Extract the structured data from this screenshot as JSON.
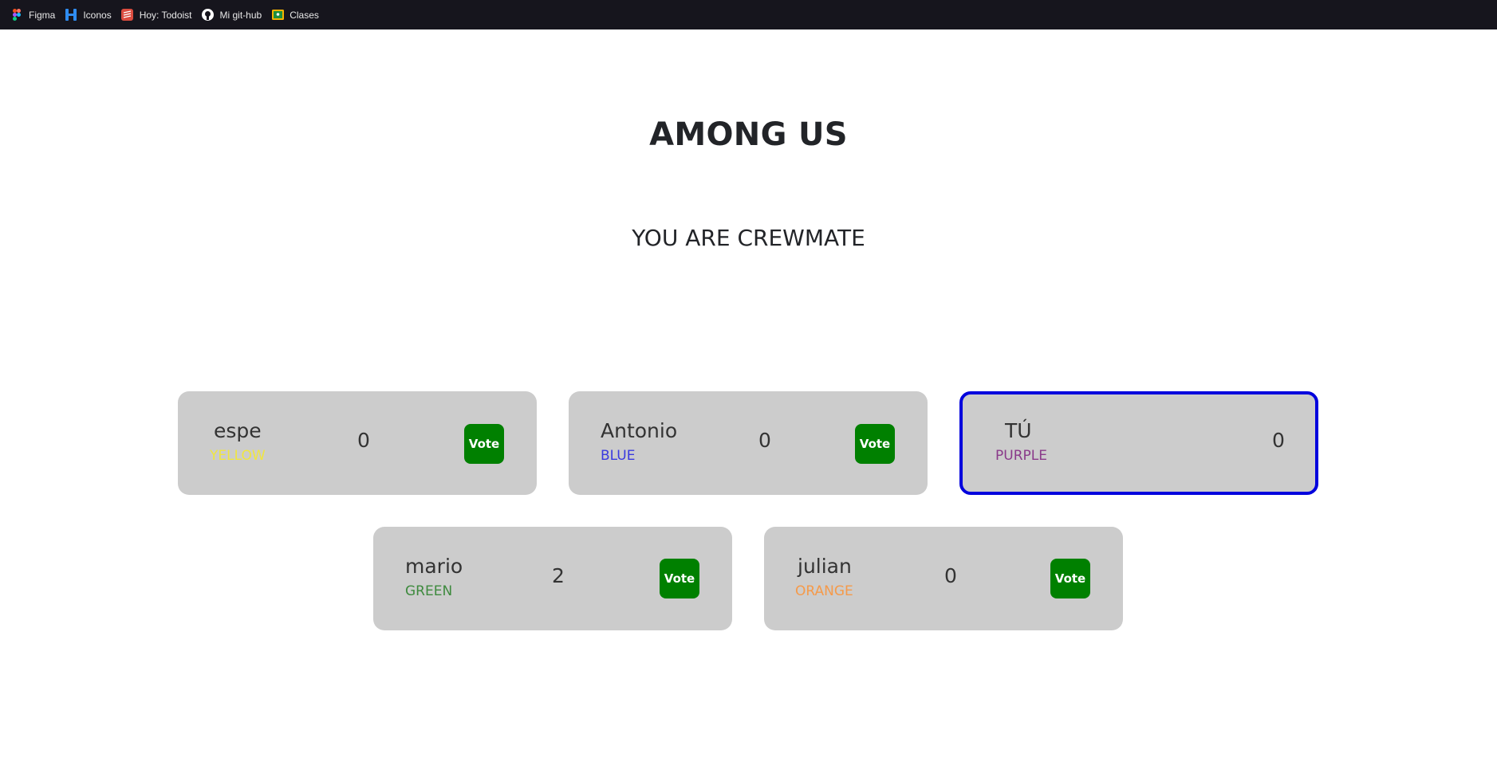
{
  "bookmarks": [
    {
      "label": "Figma",
      "icon": "figma-icon"
    },
    {
      "label": "Iconos",
      "icon": "iconos-icon"
    },
    {
      "label": "Hoy: Todoist",
      "icon": "todoist-icon"
    },
    {
      "label": "Mi git-hub",
      "icon": "github-icon"
    },
    {
      "label": "Clases",
      "icon": "classroom-icon"
    }
  ],
  "game": {
    "title": "AMONG US",
    "role": "YOU ARE CREWMATE"
  },
  "players": [
    {
      "name": "espe",
      "color_label": "YELLOW",
      "color": "#f0e640",
      "votes": "0",
      "vote_label": "Vote"
    },
    {
      "name": "Antonio",
      "color_label": "BLUE",
      "color": "#3a3adf",
      "votes": "0",
      "vote_label": "Vote"
    },
    {
      "name": "TÚ",
      "color_label": "PURPLE",
      "color": "#8a3a8a",
      "votes": "0"
    },
    {
      "name": "mario",
      "color_label": "GREEN",
      "color": "#3e8a3e",
      "votes": "2",
      "vote_label": "Vote"
    },
    {
      "name": "julian",
      "color_label": "ORANGE",
      "color": "#f59a4a",
      "votes": "0",
      "vote_label": "Vote"
    }
  ],
  "theme": {
    "card_bg": "#cccccc",
    "vote_button": "#008000",
    "self_border": "#0000dd",
    "bookmark_bar": "#16151d"
  }
}
